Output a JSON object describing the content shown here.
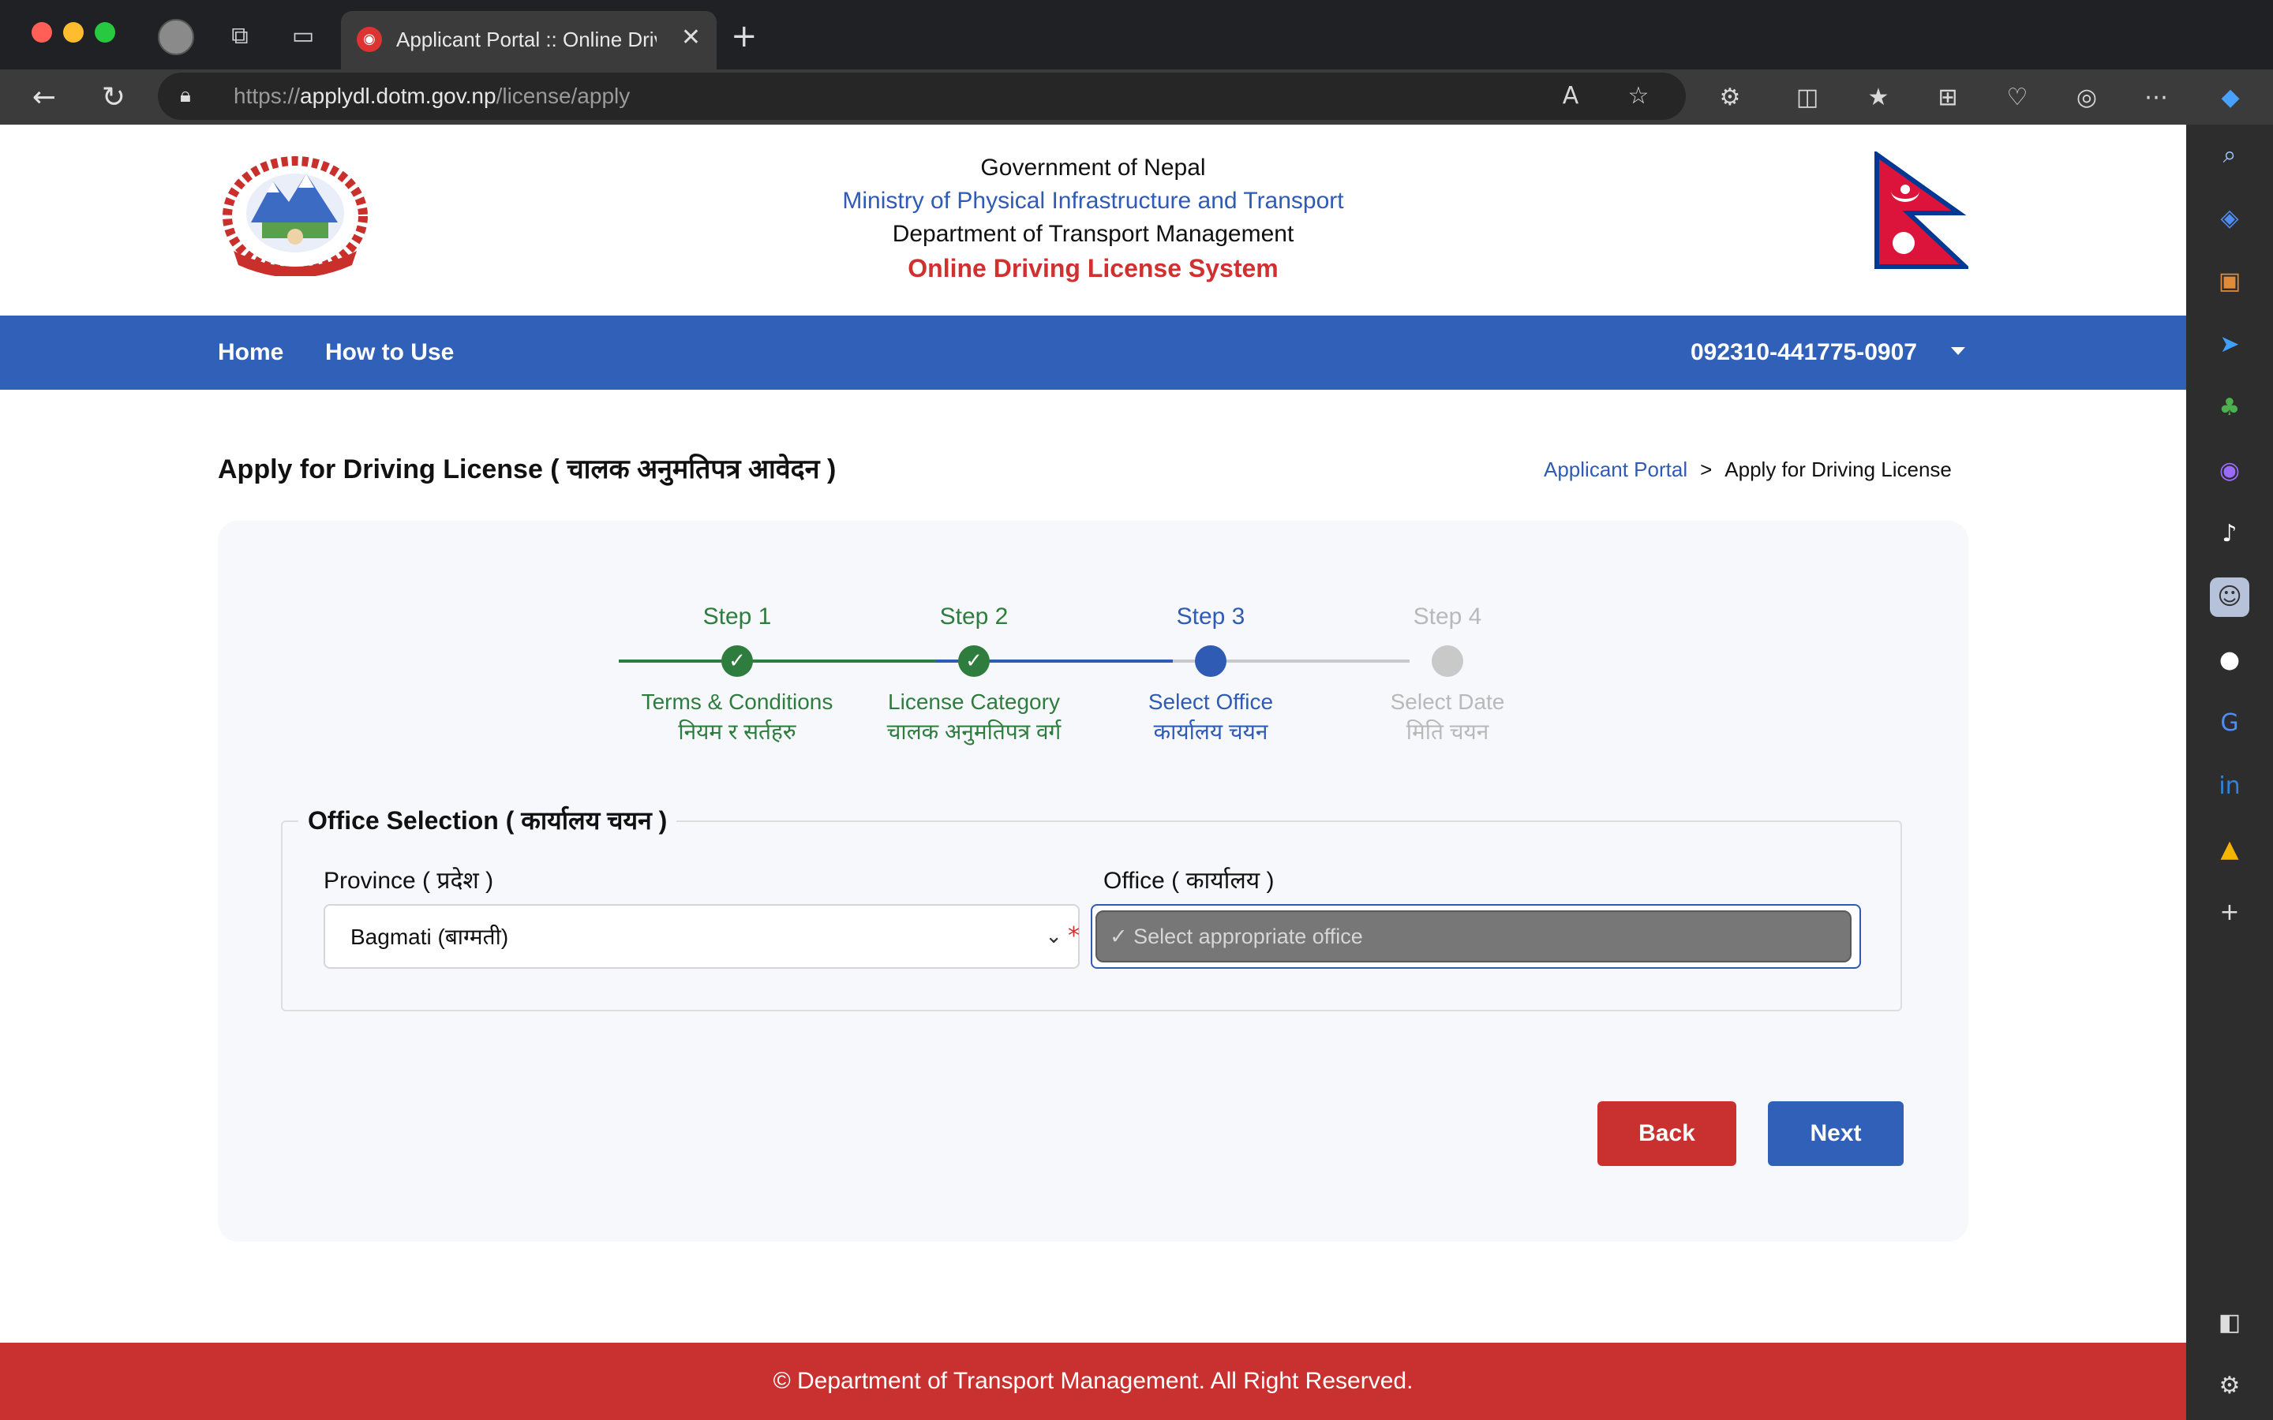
{
  "browser": {
    "tab_title": "Applicant Portal :: Online Driving License System",
    "url_scheme": "https://",
    "url_host": "applydl.dotm.gov.np",
    "url_path": "/license/apply"
  },
  "header": {
    "line1": "Government of Nepal",
    "line2": "Ministry of Physical Infrastructure and Transport",
    "line3": "Department of Transport Management",
    "line4": "Online Driving License System"
  },
  "navbar": {
    "home": "Home",
    "how_to_use": "How to Use",
    "user_id": "092310-441775-0907"
  },
  "page": {
    "title": "Apply for Driving License ( चालक अनुमतिपत्र आवेदन )",
    "breadcrumb_parent": "Applicant Portal",
    "breadcrumb_sep": ">",
    "breadcrumb_current": "Apply for Driving License"
  },
  "stepper": {
    "steps": [
      {
        "title": "Step 1",
        "label": "Terms & Conditions",
        "label_np": "नियम र सर्तहरु",
        "state": "complete"
      },
      {
        "title": "Step 2",
        "label": "License Category",
        "label_np": "चालक अनुमतिपत्र वर्ग",
        "state": "complete"
      },
      {
        "title": "Step 3",
        "label": "Select Office",
        "label_np": "कार्यालय चयन",
        "state": "active"
      },
      {
        "title": "Step 4",
        "label": "Select Date",
        "label_np": "मिति चयन",
        "state": "pending"
      }
    ],
    "check_glyph": "✓"
  },
  "office_selection": {
    "legend": "Office Selection ( कार्यालय चयन )",
    "province_label": "Province ( प्रदेश )",
    "province_value": "Bagmati (बाग्मती)",
    "office_label": "Office ( कार्यालय )",
    "office_option": "✓ Select appropriate office",
    "required_mark": "*"
  },
  "buttons": {
    "back": "Back",
    "next": "Next"
  },
  "footer": {
    "text": "© Department of Transport Management. All Right Reserved."
  },
  "colors": {
    "primary_blue": "#3160b8",
    "brand_red": "#c8312f",
    "step_green": "#2f7d3e",
    "step_grey": "#b9b9b9"
  }
}
